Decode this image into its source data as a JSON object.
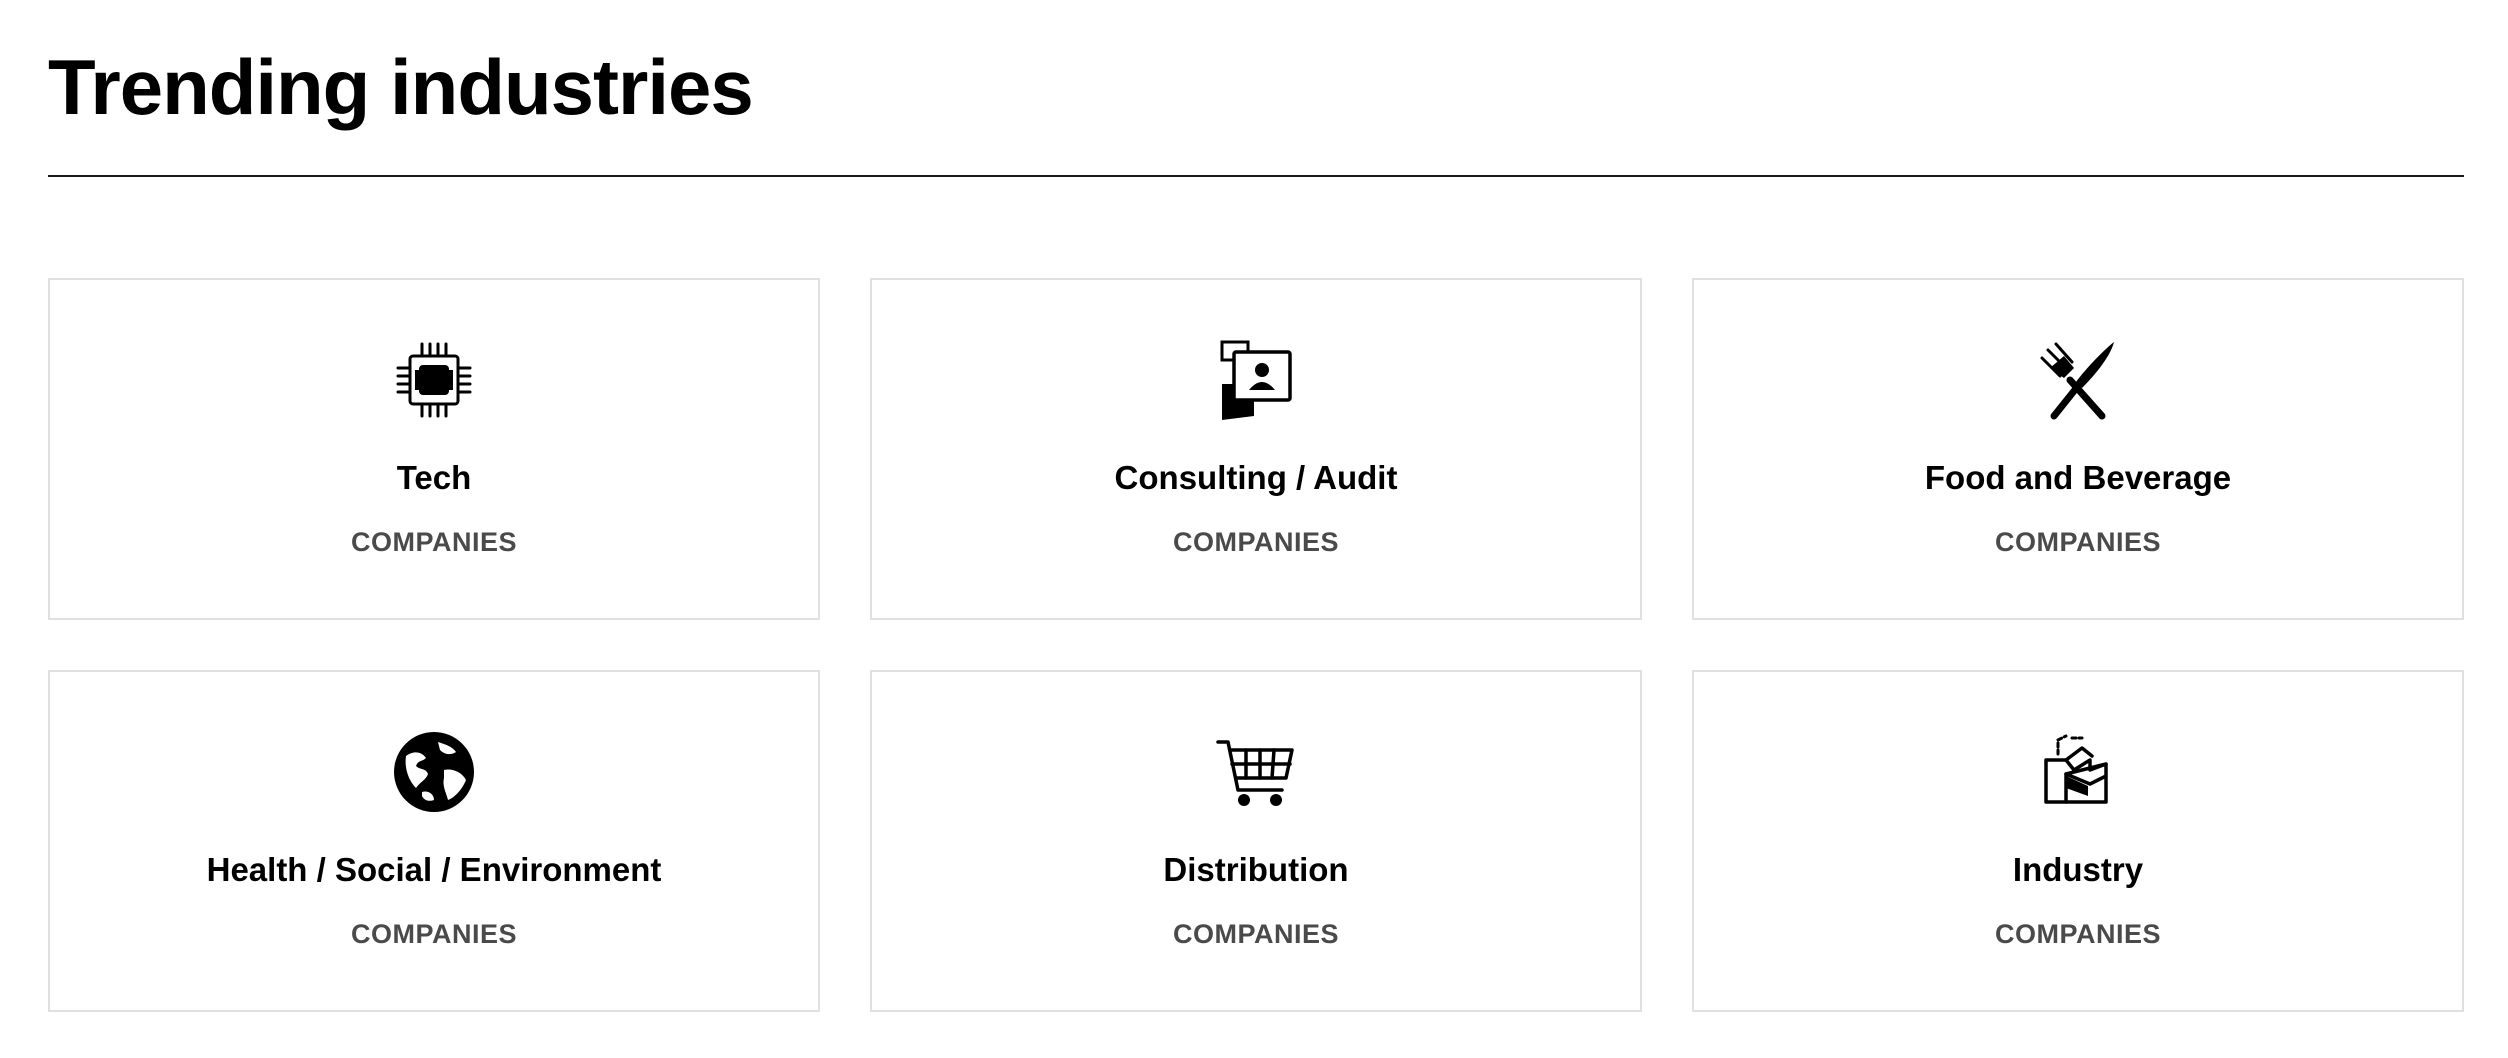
{
  "section": {
    "title": "Trending industries"
  },
  "cards": [
    {
      "name": "Tech",
      "sub": "COMPANIES",
      "icon": "microchip-icon"
    },
    {
      "name": "Consulting / Audit",
      "sub": "COMPANIES",
      "icon": "id-card-icon"
    },
    {
      "name": "Food and Beverage",
      "sub": "COMPANIES",
      "icon": "fork-knife-icon"
    },
    {
      "name": "Health / Social / Environment",
      "sub": "COMPANIES",
      "icon": "globe-icon"
    },
    {
      "name": "Distribution",
      "sub": "COMPANIES",
      "icon": "shopping-cart-icon"
    },
    {
      "name": "Industry",
      "sub": "COMPANIES",
      "icon": "factory-icon"
    }
  ],
  "colors": {
    "text": "#000000",
    "subtext": "#4a4a4a",
    "border": "#e0e0e0",
    "divider": "#1a1a1a",
    "background": "#ffffff"
  }
}
